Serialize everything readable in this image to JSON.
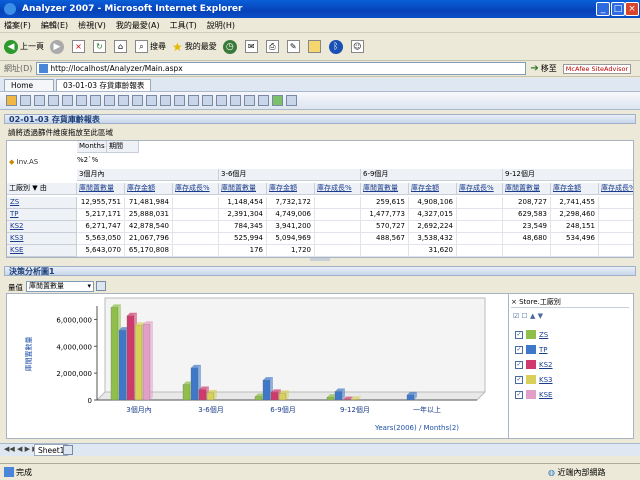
{
  "window": {
    "title": "Analyzer 2007 - Microsoft Internet Explorer"
  },
  "menu": [
    "檔案(F)",
    "編輯(E)",
    "檢視(V)",
    "我的最愛(A)",
    "工具(T)",
    "說明(H)"
  ],
  "toolbar": {
    "back": "上一頁",
    "search": "搜尋",
    "favorites": "我的最愛"
  },
  "address": {
    "label": "網址(D)",
    "url": "http://localhost/Analyzer/Main.aspx",
    "go": "移至",
    "addon": "McAfee SiteAdvisor"
  },
  "tabs": [
    "Home",
    "03-01-03 存貨庫齡報表"
  ],
  "report": {
    "title": "02-01-03 存貨庫齡報表",
    "hint": "請將透過篩件維度拖放至此區域",
    "filter": "Inv.AS",
    "col_dim1": "Months",
    "col_dim2": "期間",
    "col_level": "%2`%",
    "row_dim": "工廠別",
    "row_dim_suffix": "▼ 由",
    "periods": [
      "3個月內",
      "3-6個月",
      "6-9個月",
      "9-12個月"
    ],
    "measures": [
      "庫閒置數量",
      "庫存金額",
      "庫存成長%"
    ],
    "rows": [
      {
        "name": "ZS",
        "values": [
          "12,955,751",
          "71,481,984",
          "",
          "1,148,454",
          "7,732,172",
          "",
          "259,615",
          "4,908,106",
          "",
          "208,727",
          "2,741,455",
          ""
        ]
      },
      {
        "name": "TP",
        "values": [
          "5,217,171",
          "25,888,031",
          "",
          "2,391,304",
          "4,749,006",
          "",
          "1,477,773",
          "4,327,015",
          "",
          "629,583",
          "2,298,460",
          ""
        ]
      },
      {
        "name": "KS2",
        "values": [
          "6,271,747",
          "42,878,540",
          "",
          "784,345",
          "3,941,200",
          "",
          "570,727",
          "2,692,224",
          "",
          "23,549",
          "248,151",
          ""
        ]
      },
      {
        "name": "KS3",
        "values": [
          "5,563,050",
          "21,067,796",
          "",
          "525,994",
          "5,094,969",
          "",
          "488,567",
          "3,538,432",
          "",
          "48,680",
          "534,496",
          ""
        ]
      },
      {
        "name": "KSE",
        "values": [
          "5,643,070",
          "65,170,808",
          "",
          "176",
          "1,720",
          "",
          "",
          "31,620",
          "",
          "",
          "",
          ""
        ]
      }
    ]
  },
  "analysis": {
    "title": "決策分析圖1",
    "measure_label": "量值",
    "measure_value": "庫閒置數量"
  },
  "chart_data": {
    "type": "bar",
    "title": "",
    "ylabel": "庫閒置數量",
    "xlabel": "Years(2006) / Months(2)",
    "categories": [
      "3個月內",
      "3-6個月",
      "6-9個月",
      "9-12個月",
      "一年以上"
    ],
    "ylim": [
      0,
      7000000
    ],
    "yticks": [
      "0",
      "2,000,000",
      "4,000,000",
      "6,000,000"
    ],
    "series": [
      {
        "name": "ZS",
        "color": "#8fbf4a",
        "values": [
          6900000,
          1150000,
          260000,
          210000,
          0
        ]
      },
      {
        "name": "TP",
        "color": "#3f78c8",
        "values": [
          5200000,
          2390000,
          1480000,
          630000,
          380000
        ]
      },
      {
        "name": "KS2",
        "color": "#d0396e",
        "values": [
          6270000,
          780000,
          570000,
          24000,
          0
        ]
      },
      {
        "name": "KS3",
        "color": "#d7d05a",
        "values": [
          5560000,
          530000,
          490000,
          49000,
          0
        ]
      },
      {
        "name": "KSE",
        "color": "#e2a0c8",
        "values": [
          5640000,
          0,
          0,
          0,
          0
        ]
      }
    ],
    "legend_title": "Store.工廠別"
  },
  "sheet": {
    "tab": "Sheet1"
  },
  "status": {
    "left": "完成",
    "right": "近端內部網路"
  }
}
